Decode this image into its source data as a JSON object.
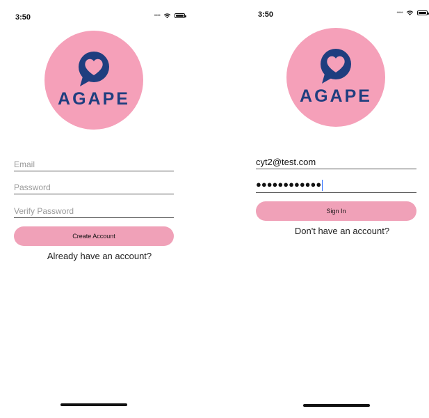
{
  "create_screen": {
    "status_bar": {
      "time": "3:50"
    },
    "logo": {
      "brand_text": "AGAPE"
    },
    "email": {
      "placeholder": "Email"
    },
    "password": {
      "placeholder": "Password"
    },
    "verify_password": {
      "placeholder": "Verify Password"
    },
    "create_button_label": "Create Account",
    "login_link": "Already have an account?"
  },
  "signin_screen": {
    "status_bar": {
      "time": "3:50"
    },
    "logo": {
      "brand_text": "AGAPE"
    },
    "email": {
      "value": "cyt2@test.com"
    },
    "password": {
      "masked_value": "●●●●●●●●●●●●"
    },
    "signin_button_label": "Sign In",
    "signup_link": "Don't have an account?"
  },
  "colors": {
    "logo_circle": "#f5a0b9",
    "logo_navy": "#1f3e7f",
    "button_pink": "#f0a1b8"
  },
  "icons": [
    "wifi-icon",
    "battery-icon",
    "speech-bubble-heart-icon"
  ]
}
